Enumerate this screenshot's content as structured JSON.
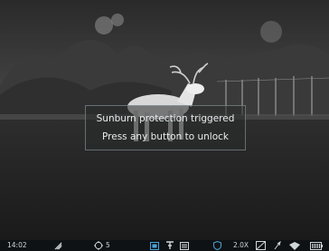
{
  "alert": {
    "line1": "Sunburn protection triggered",
    "line2": "Press any button to unlock"
  },
  "statusbar": {
    "time": "14:02",
    "target_count": "5",
    "zoom": "2.0X",
    "icons": [
      "signal-icon",
      "target-reticle-icon",
      "picture-in-picture-icon",
      "palette-icon",
      "recording-mode-icon",
      "shield-icon",
      "stadiametric-icon",
      "compass-icon",
      "wifi-icon",
      "battery-icon"
    ]
  },
  "colors": {
    "accent": "#4aa3d8",
    "text": "#cfd6d8",
    "alert_bg": "#2b3030"
  }
}
